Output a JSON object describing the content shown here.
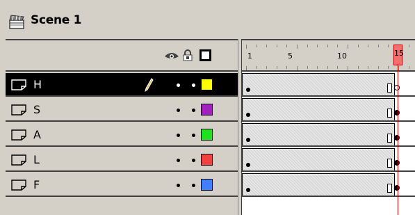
{
  "scene": {
    "title": "Scene 1",
    "icon": "clapperboard-icon"
  },
  "header": {
    "eye": "eye-icon",
    "lock": "lock-icon",
    "outline": "outline-icon"
  },
  "layers": [
    {
      "name": "H",
      "color": "#ffff00",
      "selected": true
    },
    {
      "name": "S",
      "color": "#a020c0",
      "selected": false
    },
    {
      "name": "A",
      "color": "#20e020",
      "selected": false
    },
    {
      "name": "L",
      "color": "#f04040",
      "selected": false
    },
    {
      "name": "F",
      "color": "#4080ff",
      "selected": false
    }
  ],
  "timeline": {
    "ruler_labels": [
      "1",
      "5",
      "10",
      "15"
    ],
    "current_frame": "15"
  }
}
